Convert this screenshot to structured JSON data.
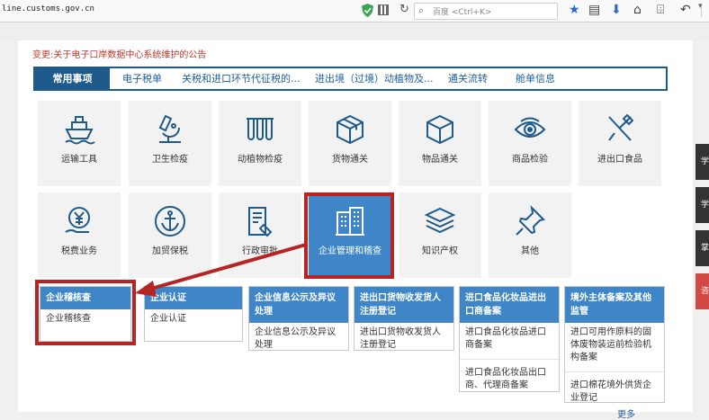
{
  "browser": {
    "url": "line.customs.gov.cn",
    "search_placeholder": "百度 <Ctrl+K>"
  },
  "notice": "变更:关于电子口岸数据中心系统维护的公告",
  "tabs": [
    {
      "label": "常用事项",
      "active": true
    },
    {
      "label": "电子税单"
    },
    {
      "label": "关税和进口环节代征税的..."
    },
    {
      "label": "进出境（过境）动植物及..."
    },
    {
      "label": "通关流转"
    },
    {
      "label": "舱单信息"
    }
  ],
  "tiles": [
    {
      "label": "运输工具",
      "icon": "ship-icon"
    },
    {
      "label": "卫生检疫",
      "icon": "microscope-icon"
    },
    {
      "label": "动植物检疫",
      "icon": "test-tubes-icon"
    },
    {
      "label": "货物通关",
      "icon": "package-icon"
    },
    {
      "label": "物品通关",
      "icon": "cube-icon"
    },
    {
      "label": "商品检验",
      "icon": "eye-icon"
    },
    {
      "label": "进出口食品",
      "icon": "fork-knife-icon"
    },
    {
      "label": "税费业务",
      "icon": "yen-icon"
    },
    {
      "label": "加贸保税",
      "icon": "anchor-icon"
    },
    {
      "label": "行政审批",
      "icon": "document-icon"
    },
    {
      "label": "企业管理和稽查",
      "icon": "building-icon",
      "highlighted": true
    },
    {
      "label": "知识产权",
      "icon": "layers-icon"
    },
    {
      "label": "其他",
      "icon": "pin-icon"
    }
  ],
  "categories": [
    {
      "title": "企业稽核查",
      "items": [
        "企业稽核查"
      ]
    },
    {
      "title": "企业认证",
      "items": [
        "企业认证"
      ]
    },
    {
      "title": "企业信息公示及异议处理",
      "items": [
        "企业信息公示及异议处理"
      ]
    },
    {
      "title": "进出口货物收发货人注册登记",
      "items": [
        "进出口货物收发货人注册登记"
      ]
    },
    {
      "title": "进口食品化妆品进出口商备案",
      "items": [
        "进口食品化妆品进口商备案",
        "进口食品化妆品出口商、代理商备案"
      ]
    },
    {
      "title": "境外主体备案及其他监管",
      "items": [
        "进口可用作原料的固体废物装运前检验机构备案",
        "进口棉花境外供货企业登记"
      ]
    }
  ],
  "right_strip": [
    "学",
    "学",
    "掌上",
    "咨"
  ],
  "more_label": "更多",
  "colors": {
    "accent": "#1e5a8a",
    "tile_blue": "#3e86c7",
    "highlight_red": "#b72424",
    "notice_red": "#c0392b"
  }
}
